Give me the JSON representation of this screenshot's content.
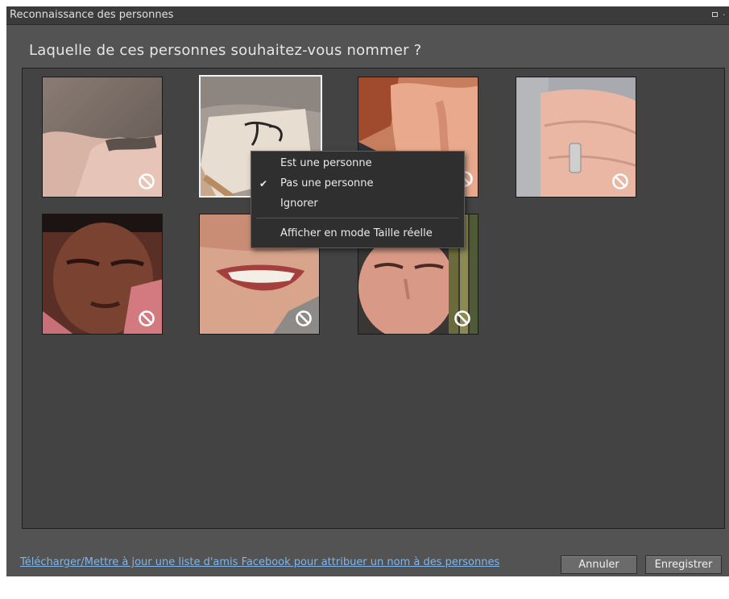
{
  "window": {
    "title": "Reconnaissance des personnes"
  },
  "question": "Laquelle de ces personnes souhaitez-vous nommer ?",
  "thumbnails": [
    {
      "subject": "hand",
      "state": "not-person"
    },
    {
      "subject": "book",
      "state": "selected"
    },
    {
      "subject": "hands",
      "state": "not-person"
    },
    {
      "subject": "ring-hand",
      "state": "not-person"
    },
    {
      "subject": "boy-face",
      "state": "not-person"
    },
    {
      "subject": "smile",
      "state": "not-person"
    },
    {
      "subject": "young-man",
      "state": "not-person"
    }
  ],
  "context_menu": {
    "items": [
      {
        "label": "Est une personne",
        "checked": false
      },
      {
        "label": "Pas une personne",
        "checked": true
      },
      {
        "label": "Ignorer",
        "checked": false
      },
      {
        "label": "Afficher en mode Taille réelle",
        "checked": false
      }
    ],
    "check_glyph": "✔"
  },
  "footer": {
    "facebook_link": "Télécharger/Mettre à jour une liste d'amis Facebook pour attribuer un nom à des personnes",
    "cancel_label": "Annuler",
    "save_label": "Enregistrer"
  },
  "colors": {
    "window_bg": "#535353",
    "panel_bg": "#434343",
    "link": "#7fb5e8"
  },
  "icons": {
    "not_person": "no-entry-icon"
  }
}
